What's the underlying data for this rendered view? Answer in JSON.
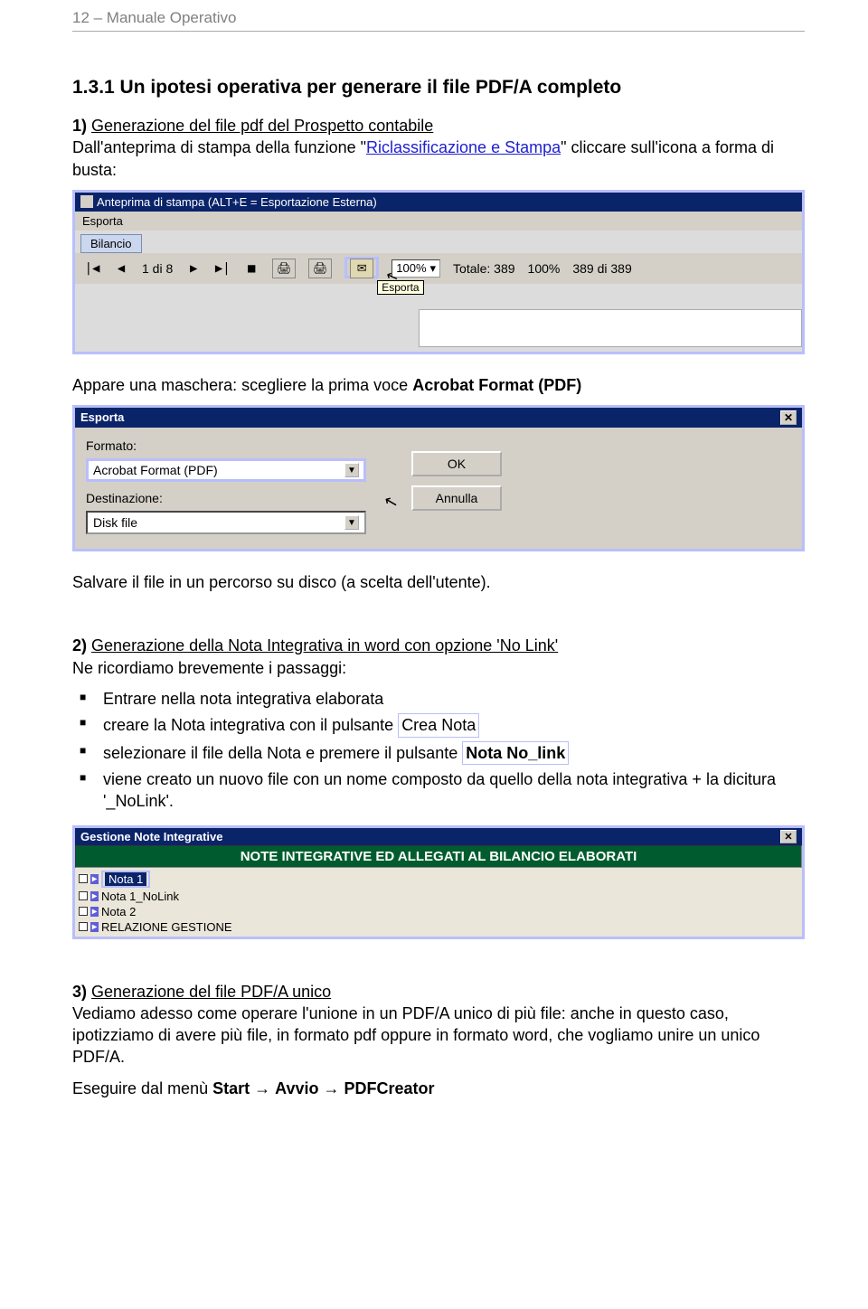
{
  "header": "12 – Manuale Operativo",
  "section_title": "1.3.1  Un ipotesi operativa per generare il file PDF/A completo",
  "step1": {
    "num": "1)",
    "title": "Generazione del file pdf del Prospetto contabile",
    "text_pre": "Dall'anteprima di stampa della funzione \"",
    "link": "Riclassificazione e Stampa",
    "text_post": "\" cliccare sull'icona a forma di busta:"
  },
  "ss1": {
    "title": "Anteprima di stampa (ALT+E = Esportazione Esterna)",
    "menu_item": "Esporta",
    "tab": "Bilancio",
    "page_info": "1 di 8",
    "zoom": "100%",
    "totale": "Totale: 389",
    "pct": "100%",
    "ratio": "389 di 389",
    "export_tooltip": "Esporta"
  },
  "after_ss1": {
    "text_pre": "Appare una maschera: scegliere la prima voce ",
    "bold": "Acrobat Format (PDF)"
  },
  "ss2": {
    "title": "Esporta",
    "label_formato": "Formato:",
    "combo_formato": "Acrobat Format (PDF)",
    "label_dest": "Destinazione:",
    "combo_dest": "Disk file",
    "btn_ok": "OK",
    "btn_annulla": "Annulla"
  },
  "after_ss2": "Salvare il file in un percorso su disco (a scelta dell'utente).",
  "step2": {
    "num": "2)",
    "title": "Generazione della Nota Integrativa in word con opzione 'No Link'",
    "sub": "Ne ricordiamo brevemente i passaggi:",
    "b1": "Entrare nella nota integrativa elaborata",
    "b2_pre": "creare la Nota integrativa con il pulsante ",
    "b2_box": "Crea Nota",
    "b3_pre": "selezionare il file della Nota e premere il pulsante ",
    "b3_box": "Nota No_link",
    "b4": "viene creato un nuovo file con un nome composto da quello della nota integrativa + la dicitura '_NoLink'."
  },
  "ss3": {
    "title": "Gestione Note Integrative",
    "banner": "NOTE INTEGRATIVE ED ALLEGATI AL BILANCIO ELABORATI",
    "items": [
      "Nota 1",
      "Nota 1_NoLink",
      "Nota 2",
      "RELAZIONE GESTIONE"
    ]
  },
  "step3": {
    "num": "3)",
    "title": "Generazione del file PDF/A unico",
    "text": "Vediamo adesso come operare l'unione in un PDF/A unico di più file: anche in questo caso, ipotizziamo di avere più file, in formato pdf oppure in formato word, che vogliamo unire un unico PDF/A.",
    "footer_pre": "Eseguire dal menù ",
    "footer_b1": "Start",
    "footer_arrow": " → ",
    "footer_b2": "Avvio",
    "footer_b3": "PDFCreator"
  }
}
